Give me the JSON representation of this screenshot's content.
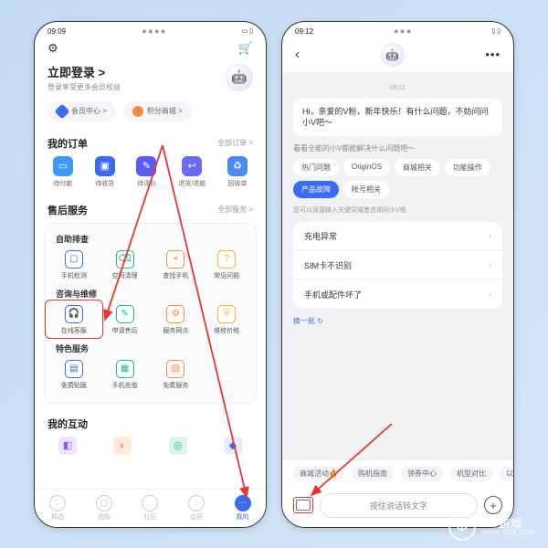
{
  "left": {
    "status_time": "09:09",
    "status_icons": "◉ ◉ ◉ ◉",
    "battery": "▭ ▯",
    "login_title": "立即登录 >",
    "login_sub": "登录享受更多会员权益",
    "pill_member": "会员中心 >",
    "pill_points": "积分商城 >",
    "orders_title": "我的订单",
    "orders_all": "全部订单 >",
    "orders": [
      "待付款",
      "待收货",
      "待评价",
      "退货/退款",
      "回收单"
    ],
    "service_title": "售后服务",
    "service_all": "全部服务 >",
    "sg1_title": "自助排查",
    "sg1": [
      "手机检测",
      "空间清理",
      "查找手机",
      "常见问题"
    ],
    "sg2_title": "咨询与维修",
    "sg2": [
      "在线客服",
      "申请售后",
      "服务网点",
      "维修价格"
    ],
    "sg3_title": "特色服务",
    "sg3": [
      "免费贴膜",
      "手机充值",
      "免费服务"
    ],
    "interact_title": "我的互动",
    "tabs": [
      "精选",
      "选购",
      "社区",
      "会员",
      "我的"
    ]
  },
  "right": {
    "status_time": "09:12",
    "status_icons": "◉ ◉ ◉",
    "battery": "▯ ▯",
    "chat_time": "09:11",
    "greeting": "Hi，亲爱的V粉，新年快乐！有什么问题，不妨问问小V吧～",
    "help_prompt": "看看全能的小V都能解决什么问题吧～",
    "chips": [
      "热门问题",
      "OriginOS",
      "商城相关",
      "功能操作",
      "产品故障",
      "帐号相关"
    ],
    "hint": "您可以直接输入关键词或者咨询问小V哦",
    "quick": [
      "充电异常",
      "SIM卡不识别",
      "手机或配件坏了"
    ],
    "refresh": "换一批 ↻",
    "suggestions": [
      "商城活动🔥",
      "购机指南",
      "领券中心",
      "机型对比",
      "以"
    ],
    "voice_placeholder": "按住说话转文字"
  },
  "watermark": {
    "brand": "CD游戏",
    "url": "WWW.CD6.COM"
  }
}
